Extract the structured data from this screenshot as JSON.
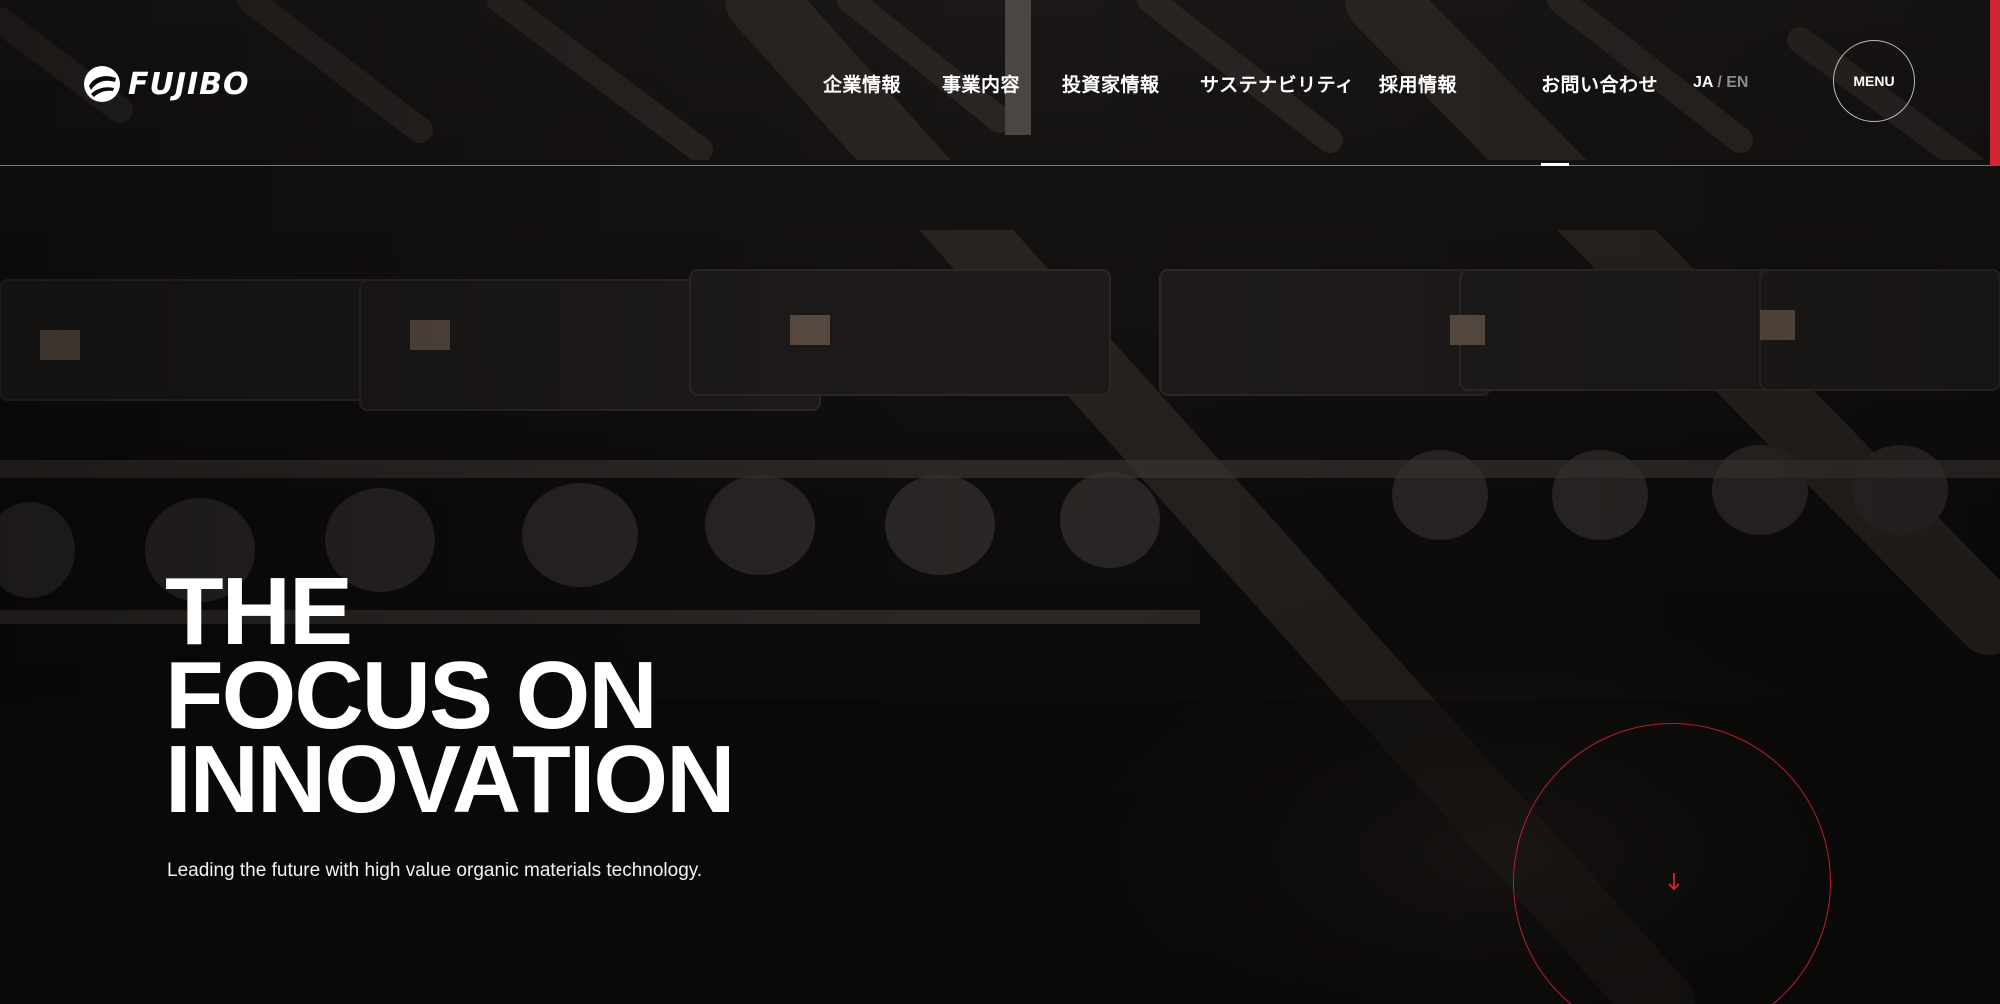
{
  "brand": {
    "name": "FUJIBO",
    "icon": "fujibo-swirl-logo-icon",
    "accent": "#d42431"
  },
  "nav": {
    "items": [
      {
        "label": "企業情報"
      },
      {
        "label": "事業内容"
      },
      {
        "label": "投資家情報"
      },
      {
        "label": "サステナビリティ"
      },
      {
        "label": "採用情報"
      },
      {
        "label": "お問い合わせ"
      }
    ],
    "lang": {
      "ja": "JA",
      "sep": "/",
      "en": "EN"
    },
    "menu_label": "MENU"
  },
  "hero": {
    "title_lines": [
      "THE",
      "FOCUS ON",
      "INNOVATION"
    ],
    "subtitle": "Leading the future with high value organic materials technology.",
    "scroll_icon": "down-arrow-icon"
  }
}
